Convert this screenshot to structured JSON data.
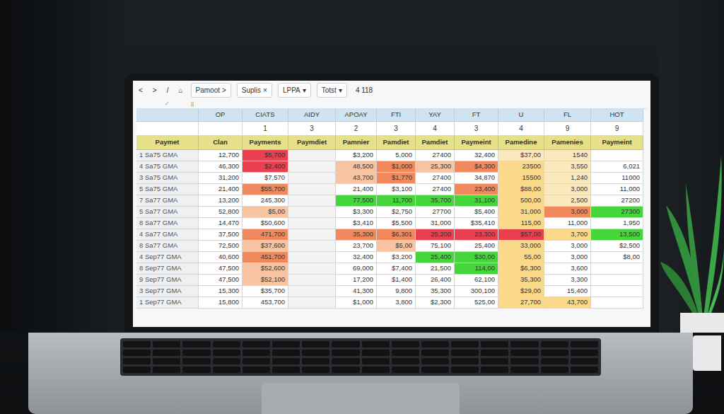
{
  "toolbar": {
    "nav": [
      "<",
      ">"
    ],
    "tools": [
      "/",
      "⌂"
    ],
    "menus": [
      {
        "label": "Pamoot",
        "mark": ">"
      },
      {
        "label": "Suplis",
        "mark": "×"
      },
      {
        "label": "LPPA",
        "mark": "▾"
      },
      {
        "label": "Totst",
        "mark": "▾"
      }
    ],
    "cell_ref": "4 118"
  },
  "formula_bar": {
    "marks": [
      "✓",
      "||"
    ]
  },
  "table": {
    "columns": [
      "",
      "OP",
      "CIATS",
      "AIDY",
      "APOAY",
      "FTI",
      "YAY",
      "FT",
      "U",
      "FL",
      "HOT"
    ],
    "numbers": [
      "",
      "",
      "1",
      "3",
      "2",
      "3",
      "4",
      "3",
      "4",
      "9",
      "9"
    ],
    "labels": [
      "Paymet",
      "Clan",
      "Payments",
      "Paymdiet",
      "Pamnier",
      "Pamdiet",
      "Pamdiet",
      "Paymeint",
      "Pamedine",
      "Pamenies",
      "Paymeint"
    ],
    "rows": [
      {
        "label": "1 Sa75 GMA",
        "cells": [
          {
            "text": "12,700",
            "color": "#ffffff"
          },
          {
            "text": "$5,700",
            "color": "#e8404f"
          },
          {
            "text": "",
            "color": "#f3f3f3"
          },
          {
            "text": "$3,200",
            "color": "#ffffff"
          },
          {
            "text": "5,000",
            "color": "#ffffff"
          },
          {
            "text": "27400",
            "color": "#ffffff"
          },
          {
            "text": "32,400",
            "color": "#ffffff"
          },
          {
            "text": "$37,00",
            "color": "#fce8bd"
          },
          {
            "text": "1540",
            "color": "#fce8bd"
          },
          {
            "text": "",
            "color": "#ffffff"
          }
        ]
      },
      {
        "label": "4 Sa75 GMA",
        "cells": [
          {
            "text": "46,300",
            "color": "#ffffff"
          },
          {
            "text": "$2,400",
            "color": "#e8404f"
          },
          {
            "text": "",
            "color": "#f3f3f3"
          },
          {
            "text": "48,500",
            "color": "#f7c3a0"
          },
          {
            "text": "$1,000",
            "color": "#f08a5d"
          },
          {
            "text": "25,300",
            "color": "#f7c3a0"
          },
          {
            "text": "$4,300",
            "color": "#f08a5d"
          },
          {
            "text": "23500",
            "color": "#fbd98a"
          },
          {
            "text": "3,550",
            "color": "#fce8bd"
          },
          {
            "text": "6,021",
            "color": "#ffffff"
          }
        ]
      },
      {
        "label": "3 Sa75 GMA",
        "cells": [
          {
            "text": "31,200",
            "color": "#ffffff"
          },
          {
            "text": "$7,570",
            "color": "#ffffff"
          },
          {
            "text": "",
            "color": "#f3f3f3"
          },
          {
            "text": "43,700",
            "color": "#f7c3a0"
          },
          {
            "text": "$1,770",
            "color": "#f08a5d"
          },
          {
            "text": "27400",
            "color": "#ffffff"
          },
          {
            "text": "34,870",
            "color": "#ffffff"
          },
          {
            "text": "15500",
            "color": "#fbd98a"
          },
          {
            "text": "1,240",
            "color": "#fce8bd"
          },
          {
            "text": "11000",
            "color": "#ffffff"
          }
        ]
      },
      {
        "label": "5 Sa75 GMA",
        "cells": [
          {
            "text": "21,400",
            "color": "#ffffff"
          },
          {
            "text": "$55,700",
            "color": "#f08a5d"
          },
          {
            "text": "",
            "color": "#f3f3f3"
          },
          {
            "text": "21,400",
            "color": "#ffffff"
          },
          {
            "text": "$3,100",
            "color": "#ffffff"
          },
          {
            "text": "27400",
            "color": "#ffffff"
          },
          {
            "text": "23,400",
            "color": "#f08a5d"
          },
          {
            "text": "$88,00",
            "color": "#fbd98a"
          },
          {
            "text": "3,000",
            "color": "#fce8bd"
          },
          {
            "text": "11,000",
            "color": "#ffffff"
          }
        ]
      },
      {
        "label": "7 Sa77 GMA",
        "cells": [
          {
            "text": "13,200",
            "color": "#ffffff"
          },
          {
            "text": "245,300",
            "color": "#ffffff"
          },
          {
            "text": "",
            "color": "#f3f3f3"
          },
          {
            "text": "77,500",
            "color": "#46d63c"
          },
          {
            "text": "11,700",
            "color": "#46d63c"
          },
          {
            "text": "35,700",
            "color": "#46d63c"
          },
          {
            "text": "31,100",
            "color": "#46d63c"
          },
          {
            "text": "500,00",
            "color": "#fbd98a"
          },
          {
            "text": "2,500",
            "color": "#fce8bd"
          },
          {
            "text": "27200",
            "color": "#ffffff"
          }
        ]
      },
      {
        "label": "5 Sa77 GMA",
        "cells": [
          {
            "text": "52,800",
            "color": "#ffffff"
          },
          {
            "text": "$5,00",
            "color": "#f7c3a0"
          },
          {
            "text": "",
            "color": "#f3f3f3"
          },
          {
            "text": "$3,300",
            "color": "#ffffff"
          },
          {
            "text": "$2,750",
            "color": "#ffffff"
          },
          {
            "text": "27700",
            "color": "#ffffff"
          },
          {
            "text": "$5,400",
            "color": "#ffffff"
          },
          {
            "text": "31,000",
            "color": "#fbd98a"
          },
          {
            "text": "3,000",
            "color": "#f08a5d"
          },
          {
            "text": "27300",
            "color": "#46d63c"
          }
        ]
      },
      {
        "label": "8 Sa77 GMA",
        "cells": [
          {
            "text": "14,470",
            "color": "#ffffff"
          },
          {
            "text": "$50,600",
            "color": "#ffffff"
          },
          {
            "text": "",
            "color": "#f3f3f3"
          },
          {
            "text": "$3,410",
            "color": "#ffffff"
          },
          {
            "text": "$5,500",
            "color": "#ffffff"
          },
          {
            "text": "31,000",
            "color": "#ffffff"
          },
          {
            "text": "$35,410",
            "color": "#ffffff"
          },
          {
            "text": "115,00",
            "color": "#fbd98a"
          },
          {
            "text": "11,000",
            "color": "#ffffff"
          },
          {
            "text": "1,950",
            "color": "#ffffff"
          }
        ]
      },
      {
        "label": "4 Sa77 GMA",
        "cells": [
          {
            "text": "37,500",
            "color": "#ffffff"
          },
          {
            "text": "471,700",
            "color": "#f08a5d"
          },
          {
            "text": "",
            "color": "#f3f3f3"
          },
          {
            "text": "35,300",
            "color": "#f08a5d"
          },
          {
            "text": "$6,301",
            "color": "#f08a5d"
          },
          {
            "text": "25,200",
            "color": "#e8404f"
          },
          {
            "text": "23,300",
            "color": "#e8404f"
          },
          {
            "text": "$57,00",
            "color": "#e8404f"
          },
          {
            "text": "3,700",
            "color": "#fbd98a"
          },
          {
            "text": "13,500",
            "color": "#46d63c"
          }
        ]
      },
      {
        "label": "8 Sa77 GMA",
        "cells": [
          {
            "text": "72,500",
            "color": "#ffffff"
          },
          {
            "text": "$37,600",
            "color": "#f7c3a0"
          },
          {
            "text": "",
            "color": "#f3f3f3"
          },
          {
            "text": "23,700",
            "color": "#ffffff"
          },
          {
            "text": "$5,00",
            "color": "#f7c3a0"
          },
          {
            "text": "75,100",
            "color": "#ffffff"
          },
          {
            "text": "25,400",
            "color": "#ffffff"
          },
          {
            "text": "33,000",
            "color": "#fbd98a"
          },
          {
            "text": "3,000",
            "color": "#ffffff"
          },
          {
            "text": "$2,500",
            "color": "#ffffff"
          }
        ]
      },
      {
        "label": "4 Sep77 GMA",
        "cells": [
          {
            "text": "40,600",
            "color": "#ffffff"
          },
          {
            "text": "451,700",
            "color": "#f08a5d"
          },
          {
            "text": "",
            "color": "#f3f3f3"
          },
          {
            "text": "32,400",
            "color": "#ffffff"
          },
          {
            "text": "$3,200",
            "color": "#ffffff"
          },
          {
            "text": "25,400",
            "color": "#46d63c"
          },
          {
            "text": "$30,00",
            "color": "#46d63c"
          },
          {
            "text": "55,00",
            "color": "#fbd98a"
          },
          {
            "text": "3,000",
            "color": "#ffffff"
          },
          {
            "text": "$8,00",
            "color": "#ffffff"
          }
        ]
      },
      {
        "label": "8 Sep77 GMA",
        "cells": [
          {
            "text": "47,500",
            "color": "#ffffff"
          },
          {
            "text": "$52,600",
            "color": "#f7c3a0"
          },
          {
            "text": "",
            "color": "#f3f3f3"
          },
          {
            "text": "69,000",
            "color": "#ffffff"
          },
          {
            "text": "$7,400",
            "color": "#ffffff"
          },
          {
            "text": "21,500",
            "color": "#ffffff"
          },
          {
            "text": "114,00",
            "color": "#46d63c"
          },
          {
            "text": "$6,300",
            "color": "#fbd98a"
          },
          {
            "text": "3,600",
            "color": "#ffffff"
          },
          {
            "text": "",
            "color": "#ffffff"
          }
        ]
      },
      {
        "label": "9 Sep77 GMA",
        "cells": [
          {
            "text": "47,500",
            "color": "#ffffff"
          },
          {
            "text": "$52,100",
            "color": "#f7c3a0"
          },
          {
            "text": "",
            "color": "#f3f3f3"
          },
          {
            "text": "17,200",
            "color": "#ffffff"
          },
          {
            "text": "$1,400",
            "color": "#ffffff"
          },
          {
            "text": "26,400",
            "color": "#ffffff"
          },
          {
            "text": "62,100",
            "color": "#ffffff"
          },
          {
            "text": "35,300",
            "color": "#fbd98a"
          },
          {
            "text": "3,300",
            "color": "#ffffff"
          },
          {
            "text": "",
            "color": "#ffffff"
          }
        ]
      },
      {
        "label": "3 Sep77 GMA",
        "cells": [
          {
            "text": "15,300",
            "color": "#ffffff"
          },
          {
            "text": "$35,700",
            "color": "#ffffff"
          },
          {
            "text": "",
            "color": "#f3f3f3"
          },
          {
            "text": "41,300",
            "color": "#ffffff"
          },
          {
            "text": "9,800",
            "color": "#ffffff"
          },
          {
            "text": "35,300",
            "color": "#ffffff"
          },
          {
            "text": "300,100",
            "color": "#ffffff"
          },
          {
            "text": "$29,00",
            "color": "#fbd98a"
          },
          {
            "text": "15,400",
            "color": "#ffffff"
          },
          {
            "text": "",
            "color": "#ffffff"
          }
        ]
      },
      {
        "label": "1 Sep77 GMA",
        "cells": [
          {
            "text": "15,800",
            "color": "#ffffff"
          },
          {
            "text": "453,700",
            "color": "#ffffff"
          },
          {
            "text": "",
            "color": "#f3f3f3"
          },
          {
            "text": "$1,000",
            "color": "#ffffff"
          },
          {
            "text": "3,800",
            "color": "#ffffff"
          },
          {
            "text": "$2,300",
            "color": "#ffffff"
          },
          {
            "text": "525,00",
            "color": "#ffffff"
          },
          {
            "text": "27,700",
            "color": "#fbd98a"
          },
          {
            "text": "43,700",
            "color": "#fbd98a"
          },
          {
            "text": "",
            "color": "#ffffff"
          }
        ]
      }
    ]
  }
}
